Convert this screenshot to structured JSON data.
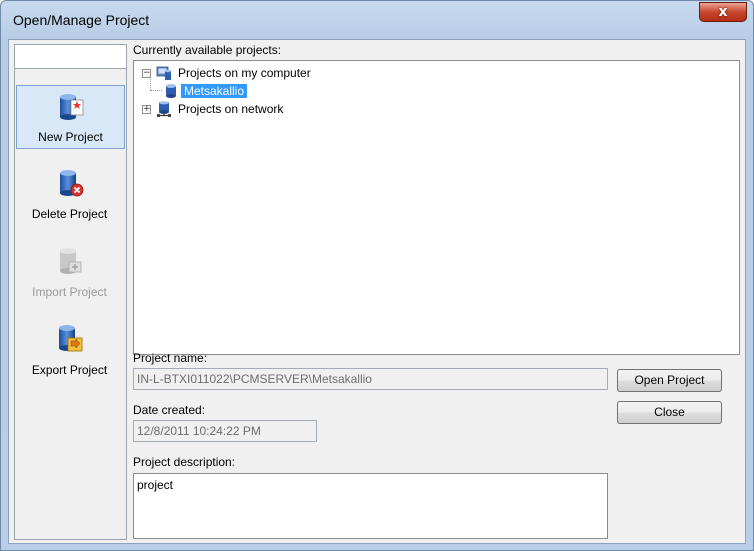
{
  "window": {
    "title": "Open/Manage Project",
    "close_glyph": "x"
  },
  "sidebar": {
    "items": [
      {
        "label": "New Project",
        "icon": "new-project-icon",
        "selected": true,
        "enabled": true
      },
      {
        "label": "Delete Project",
        "icon": "delete-project-icon",
        "selected": false,
        "enabled": true
      },
      {
        "label": "Import Project",
        "icon": "import-project-icon",
        "selected": false,
        "enabled": false
      },
      {
        "label": "Export Project",
        "icon": "export-project-icon",
        "selected": false,
        "enabled": true
      }
    ]
  },
  "projects": {
    "label": "Currently available projects:",
    "tree": [
      {
        "label": "Projects on my computer",
        "expanded": true,
        "expander": "−",
        "icon": "computer-database-icon",
        "children": [
          {
            "label": "Metsakallio",
            "selected": true,
            "icon": "database-icon"
          }
        ]
      },
      {
        "label": "Projects on network",
        "expanded": false,
        "expander": "+",
        "icon": "network-database-icon"
      }
    ]
  },
  "details": {
    "name_label": "Project name:",
    "name_value": "IN-L-BTXI011022\\PCMSERVER\\Metsakallio",
    "date_label": "Date created:",
    "date_value": "12/8/2011 10:24:22 PM",
    "description_label": "Project description:",
    "description_value": "project"
  },
  "buttons": {
    "open": "Open Project",
    "close": "Close"
  },
  "colors": {
    "selection": "#3399ff",
    "title_gradient": "#c7d9ee",
    "close_button": "#c9482f"
  }
}
